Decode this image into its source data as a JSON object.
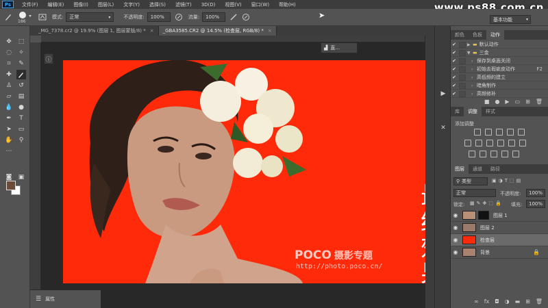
{
  "app": {
    "logo": "Ps",
    "watermark": "www.ps88.com.cn"
  },
  "menu": [
    "文件(F)",
    "编辑(E)",
    "图像(I)",
    "图层(L)",
    "文字(Y)",
    "选择(S)",
    "滤镜(T)",
    "3D(D)",
    "视图(V)",
    "窗口(W)",
    "帮助(H)"
  ],
  "options": {
    "brush_size": "186",
    "mode_label": "模式:",
    "mode_value": "正常",
    "opacity_label": "不透明度:",
    "opacity_value": "100%",
    "flow_label": "流量:",
    "flow_value": "100%",
    "workspace": "基本功能"
  },
  "tabs": [
    {
      "label": "_MG_7378.cr2 @ 19.9% (图层 1, 图层蒙版/8) *",
      "active": false
    },
    {
      "label": "_GBA3585.CR2 @ 14.5% (检查层, RGB/8) *",
      "active": true
    }
  ],
  "float_panel": {
    "label": "直..."
  },
  "properties_panel": {
    "label": "属性"
  },
  "canvas": {
    "background": "#ff2a0a",
    "title_chars": [
      "最",
      "终",
      "效",
      "果"
    ],
    "brand_en": "POCO",
    "brand_cn": "摄影专题",
    "url": "http://photo.poco.cn/"
  },
  "top_panel": {
    "tabs": [
      "颜色",
      "色板",
      "动作"
    ],
    "active_tab": "动作",
    "actions": [
      {
        "label": "默认动作",
        "folder": true,
        "key": ""
      },
      {
        "label": "三金",
        "folder": true,
        "key": ""
      },
      {
        "label": "保存到桌面关闭",
        "folder": false,
        "key": ""
      },
      {
        "label": "初始去瑕疵皮动作",
        "folder": false,
        "key": "F2"
      },
      {
        "label": "高低频的建立",
        "folder": false,
        "key": ""
      },
      {
        "label": "暗角制作",
        "folder": false,
        "key": ""
      },
      {
        "label": "高频修补",
        "folder": false,
        "key": ""
      }
    ]
  },
  "adjust_panel": {
    "tabs": [
      "库",
      "调整",
      "样式"
    ],
    "active_tab": "调整",
    "add_label": "添加调整"
  },
  "layers_panel": {
    "tabs": [
      "图层",
      "通道",
      "路径"
    ],
    "active_tab": "图层",
    "filter_label": "类型",
    "blend_mode": "正常",
    "opacity_label": "不透明度:",
    "opacity_value": "100%",
    "lock_label": "锁定:",
    "fill_label": "填充:",
    "fill_value": "100%",
    "layers": [
      {
        "name": "图层 1",
        "selected": false,
        "locked": false,
        "thumb": "#b89078"
      },
      {
        "name": "图层 2",
        "selected": false,
        "locked": false,
        "thumb": "#9a7b6a"
      },
      {
        "name": "检查层",
        "selected": true,
        "locked": false,
        "thumb": "#ff2a0a"
      },
      {
        "name": "背景",
        "selected": false,
        "locked": true,
        "thumb": "#a8826e"
      }
    ]
  }
}
